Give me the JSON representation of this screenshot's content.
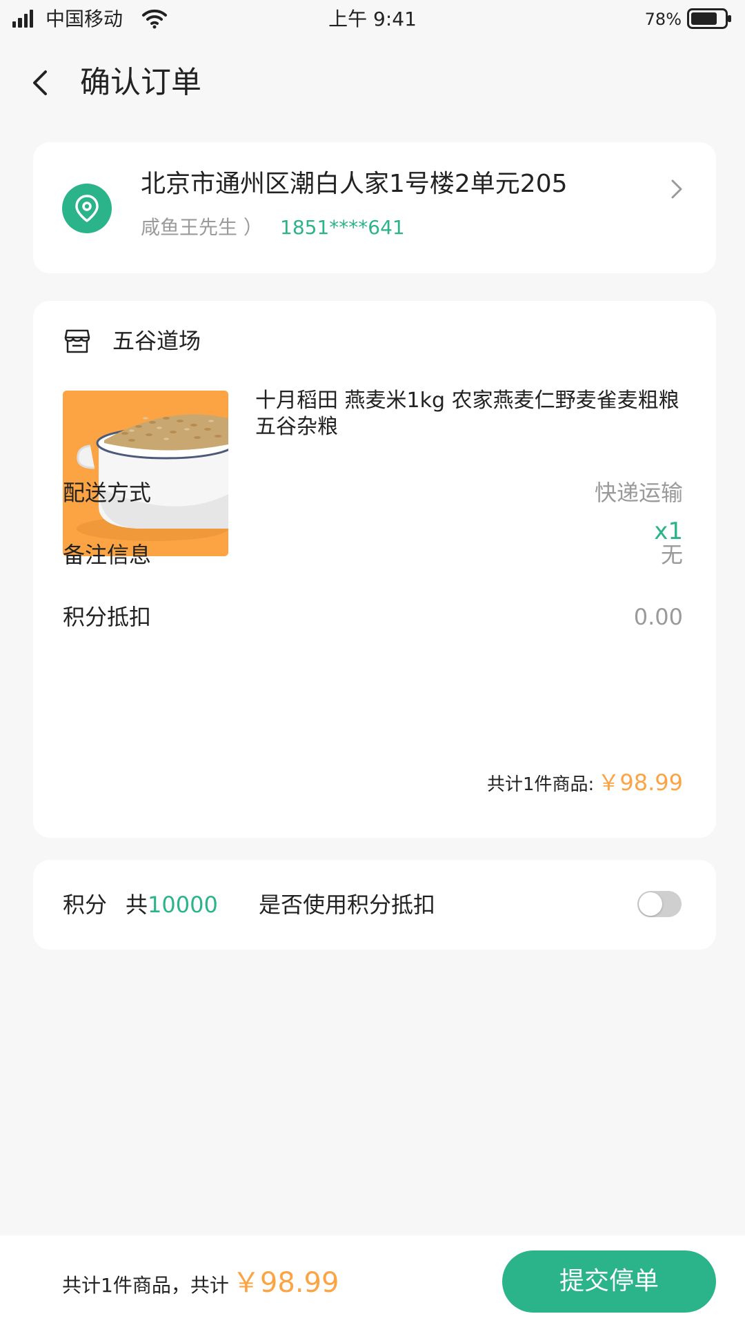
{
  "status_bar": {
    "carrier": "中国移动",
    "time": "上午 9:41",
    "battery_percent": "78%",
    "battery_level": 0.78,
    "icons": [
      "signal-icon",
      "wifi-icon",
      "battery-icon"
    ]
  },
  "header": {
    "title": "确认订单",
    "back_icon": "chevron-left-icon"
  },
  "address": {
    "icon": "location-pin-icon",
    "full_address": "北京市通州区潮白人家1号楼2单元205",
    "recipient": "咸鱼王先生 ）",
    "phone": "1851****641",
    "chevron_icon": "chevron-right-icon"
  },
  "order": {
    "shop_icon": "store-icon",
    "shop_name": "五谷道场",
    "product": {
      "title": "十月稻田 燕麦米1kg 农家燕麦仁野麦雀麦粗粮五谷杂粮",
      "quantity": "x1",
      "image": "oat-bowl-image"
    },
    "rows": [
      {
        "label": "配送方式",
        "value": "快递运输"
      },
      {
        "label": "备注信息",
        "value": "无"
      },
      {
        "label": "积分抵扣",
        "value": "0.00"
      }
    ],
    "total_label": "共计1件商品:",
    "total_price": "￥98.99"
  },
  "points": {
    "label": "积分",
    "prefix": "共",
    "total": "10000",
    "use_question": "是否使用积分抵扣",
    "toggle_on": false
  },
  "bottom_bar": {
    "summary_label": "共计1件商品，共计",
    "price": "￥98.99",
    "submit_label": "提交停单"
  },
  "colors": {
    "accent_green": "#2bb389",
    "price_orange": "#fca443",
    "muted_gray": "#9a9a9a",
    "background": "#f7f7f7"
  }
}
